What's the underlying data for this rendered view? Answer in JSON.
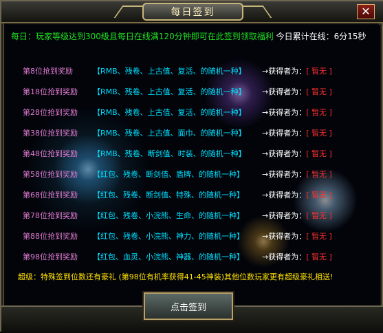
{
  "window": {
    "title": "每日签到",
    "close_label": "✕"
  },
  "intro": {
    "text": "每日：玩家等级达到300级且每日在线满120分钟即可在此签到领取福利",
    "online_label": "今日累计在线：",
    "online_value": "6分15秒"
  },
  "rewards": [
    {
      "rank": "第8位抢到奖励",
      "reward": "【RMB、残卷、上古值、复活、的随机一种】",
      "winner_label": "→获得者为：",
      "winner": "[ 暂无 ]"
    },
    {
      "rank": "第18位抢到奖励",
      "reward": "【RMB、残卷、上古值、复活、的随机一种】",
      "winner_label": "→获得者为：",
      "winner": "[ 暂无 ]"
    },
    {
      "rank": "第28位抢到奖励",
      "reward": "【RMB、残卷、上古值、复活、的随机一种】",
      "winner_label": "→获得者为：",
      "winner": "[ 暂无 ]"
    },
    {
      "rank": "第38位抢到奖励",
      "reward": "【RMB、残卷、上古值、面巾、的随机一种】",
      "winner_label": "→获得者为：",
      "winner": "[ 暂无 ]"
    },
    {
      "rank": "第48位抢到奖励",
      "reward": "【RMB、残卷、断剑值、时装、的随机一种】",
      "winner_label": "→获得者为：",
      "winner": "[ 暂无 ]"
    },
    {
      "rank": "第58位抢到奖励",
      "reward": "【红包、残卷、断剑值、盾牌、的随机一种】",
      "winner_label": "→获得者为：",
      "winner": "[ 暂无 ]"
    },
    {
      "rank": "第68位抢到奖励",
      "reward": "【红包、残卷、断剑值、特殊、的随机一种】",
      "winner_label": "→获得者为：",
      "winner": "[ 暂无 ]"
    },
    {
      "rank": "第78位抢到奖励",
      "reward": "【红包、残卷、小浣熊、生命、的随机一种】",
      "winner_label": "→获得者为：",
      "winner": "[ 暂无 ]"
    },
    {
      "rank": "第88位抢到奖励",
      "reward": "【红包、残卷、小浣熊、神力、的随机一种】",
      "winner_label": "→获得者为：",
      "winner": "[ 暂无 ]"
    },
    {
      "rank": "第98位抢到奖励",
      "reward": "【红包、血灵、小浣熊、神器、的随机一种】",
      "winner_label": "→获得者为：",
      "winner": "[ 暂无 ]"
    }
  ],
  "footer": {
    "text": "超级：特殊签到位数还有豪礼 (第98位有机率获得41-45神装)其他位数玩家更有超级豪礼相送!"
  },
  "sign_button": {
    "label": "点击签到"
  },
  "colors": {
    "intro": "#20e020",
    "rank": "#e07ad0",
    "reward": "#00e0ff",
    "winner": "#ff3030",
    "footer": "#ffe000"
  }
}
